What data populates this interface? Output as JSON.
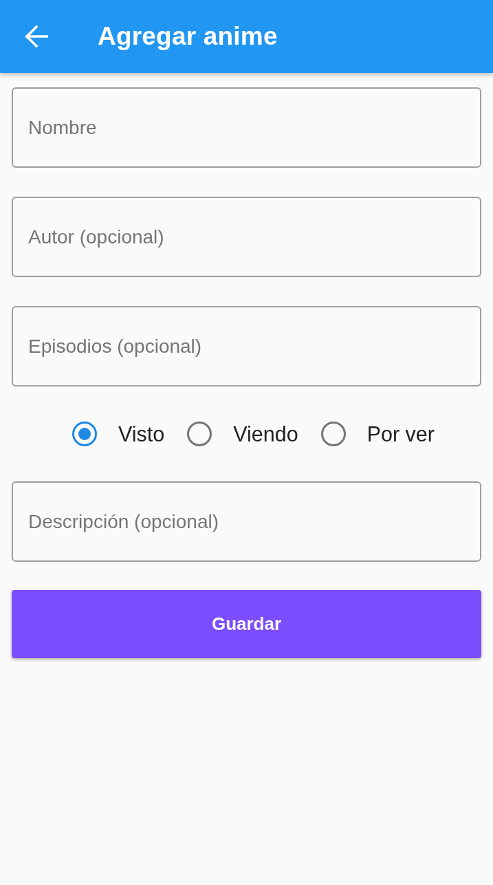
{
  "app_bar": {
    "title": "Agregar anime"
  },
  "fields": [
    {
      "placeholder": "Nombre"
    },
    {
      "placeholder": "Autor (opcional)"
    },
    {
      "placeholder": "Episodios (opcional)"
    }
  ],
  "status_options": [
    {
      "label": "Visto",
      "selected": true
    },
    {
      "label": "Viendo",
      "selected": false
    },
    {
      "label": "Por ver",
      "selected": false
    }
  ],
  "description_field": {
    "placeholder": "Descripción (opcional)"
  },
  "save_button": {
    "label": "Guardar"
  }
}
